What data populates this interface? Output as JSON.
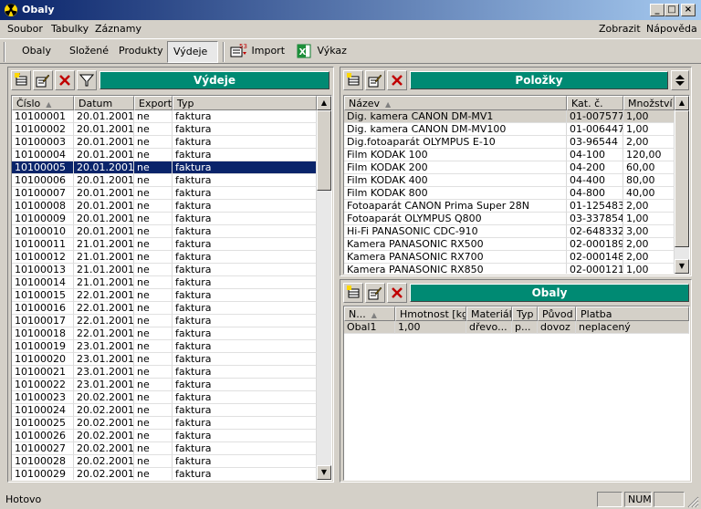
{
  "window": {
    "title": "Obaly"
  },
  "menu": {
    "soubor": "Soubor",
    "tabulky": "Tabulky",
    "zaznamy": "Záznamy",
    "zobrazit": "Zobrazit",
    "napoveda": "Nápověda"
  },
  "toolbar": {
    "obaly": "Obaly",
    "slozene": "Složené",
    "produkty": "Produkty",
    "vydeje": "Výdeje",
    "import": "Import",
    "vykaz": "Výkaz"
  },
  "vydeje": {
    "title": "Výdeje",
    "columns": [
      "Číslo",
      "Datum",
      "Export",
      "Typ"
    ],
    "selected_index": 4,
    "rows": [
      [
        "10100001",
        "20.01.2001",
        "ne",
        "faktura"
      ],
      [
        "10100002",
        "20.01.2001",
        "ne",
        "faktura"
      ],
      [
        "10100003",
        "20.01.2001",
        "ne",
        "faktura"
      ],
      [
        "10100004",
        "20.01.2001",
        "ne",
        "faktura"
      ],
      [
        "10100005",
        "20.01.2001",
        "ne",
        "faktura"
      ],
      [
        "10100006",
        "20.01.2001",
        "ne",
        "faktura"
      ],
      [
        "10100007",
        "20.01.2001",
        "ne",
        "faktura"
      ],
      [
        "10100008",
        "20.01.2001",
        "ne",
        "faktura"
      ],
      [
        "10100009",
        "20.01.2001",
        "ne",
        "faktura"
      ],
      [
        "10100010",
        "20.01.2001",
        "ne",
        "faktura"
      ],
      [
        "10100011",
        "21.01.2001",
        "ne",
        "faktura"
      ],
      [
        "10100012",
        "21.01.2001",
        "ne",
        "faktura"
      ],
      [
        "10100013",
        "21.01.2001",
        "ne",
        "faktura"
      ],
      [
        "10100014",
        "21.01.2001",
        "ne",
        "faktura"
      ],
      [
        "10100015",
        "22.01.2001",
        "ne",
        "faktura"
      ],
      [
        "10100016",
        "22.01.2001",
        "ne",
        "faktura"
      ],
      [
        "10100017",
        "22.01.2001",
        "ne",
        "faktura"
      ],
      [
        "10100018",
        "22.01.2001",
        "ne",
        "faktura"
      ],
      [
        "10100019",
        "23.01.2001",
        "ne",
        "faktura"
      ],
      [
        "10100020",
        "23.01.2001",
        "ne",
        "faktura"
      ],
      [
        "10100021",
        "23.01.2001",
        "ne",
        "faktura"
      ],
      [
        "10100022",
        "23.01.2001",
        "ne",
        "faktura"
      ],
      [
        "10100023",
        "20.02.2001",
        "ne",
        "faktura"
      ],
      [
        "10100024",
        "20.02.2001",
        "ne",
        "faktura"
      ],
      [
        "10100025",
        "20.02.2001",
        "ne",
        "faktura"
      ],
      [
        "10100026",
        "20.02.2001",
        "ne",
        "faktura"
      ],
      [
        "10100027",
        "20.02.2001",
        "ne",
        "faktura"
      ],
      [
        "10100028",
        "20.02.2001",
        "ne",
        "faktura"
      ],
      [
        "10100029",
        "20.02.2001",
        "ne",
        "faktura"
      ]
    ]
  },
  "polozky": {
    "title": "Položky",
    "columns": [
      "Název",
      "Kat. č.",
      "Množství"
    ],
    "selected_index": 0,
    "rows": [
      [
        "Dig. kamera CANON DM-MV1",
        "01-007577",
        "1,00"
      ],
      [
        "Dig. kamera CANON DM-MV100",
        "01-006447",
        "1,00"
      ],
      [
        "Dig.fotoaparát OLYMPUS E-10",
        "03-96544",
        "2,00"
      ],
      [
        "Film KODAK 100",
        "04-100",
        "120,00"
      ],
      [
        "Film KODAK 200",
        "04-200",
        "60,00"
      ],
      [
        "Film KODAK 400",
        "04-400",
        "80,00"
      ],
      [
        "Film KODAK 800",
        "04-800",
        "40,00"
      ],
      [
        "Fotoaparát CANON Prima Super 28N",
        "01-125483",
        "2,00"
      ],
      [
        "Fotoaparát OLYMPUS Q800",
        "03-337854",
        "1,00"
      ],
      [
        "Hi-Fi PANASONIC CDC-910",
        "02-648332",
        "3,00"
      ],
      [
        "Kamera PANASONIC RX500",
        "02-000189",
        "2,00"
      ],
      [
        "Kamera PANASONIC RX700",
        "02-000148",
        "2,00"
      ],
      [
        "Kamera PANASONIC RX850",
        "02-000121",
        "1,00"
      ]
    ]
  },
  "obaly": {
    "title": "Obaly",
    "columns": [
      "N...",
      "Hmotnost [kg]",
      "Materiál",
      "Typ",
      "Původ",
      "Platba"
    ],
    "selected_index": 0,
    "rows": [
      [
        "Obal1",
        "1,00",
        "dřevo...",
        "p...",
        "dovoz",
        "neplacený"
      ]
    ]
  },
  "status": {
    "text": "Hotovo",
    "num": "NUM"
  },
  "colors": {
    "title_bar": "#0a246a",
    "panel_title": "#008a73",
    "selection": "#0a246a",
    "face": "#d4d0c8"
  }
}
